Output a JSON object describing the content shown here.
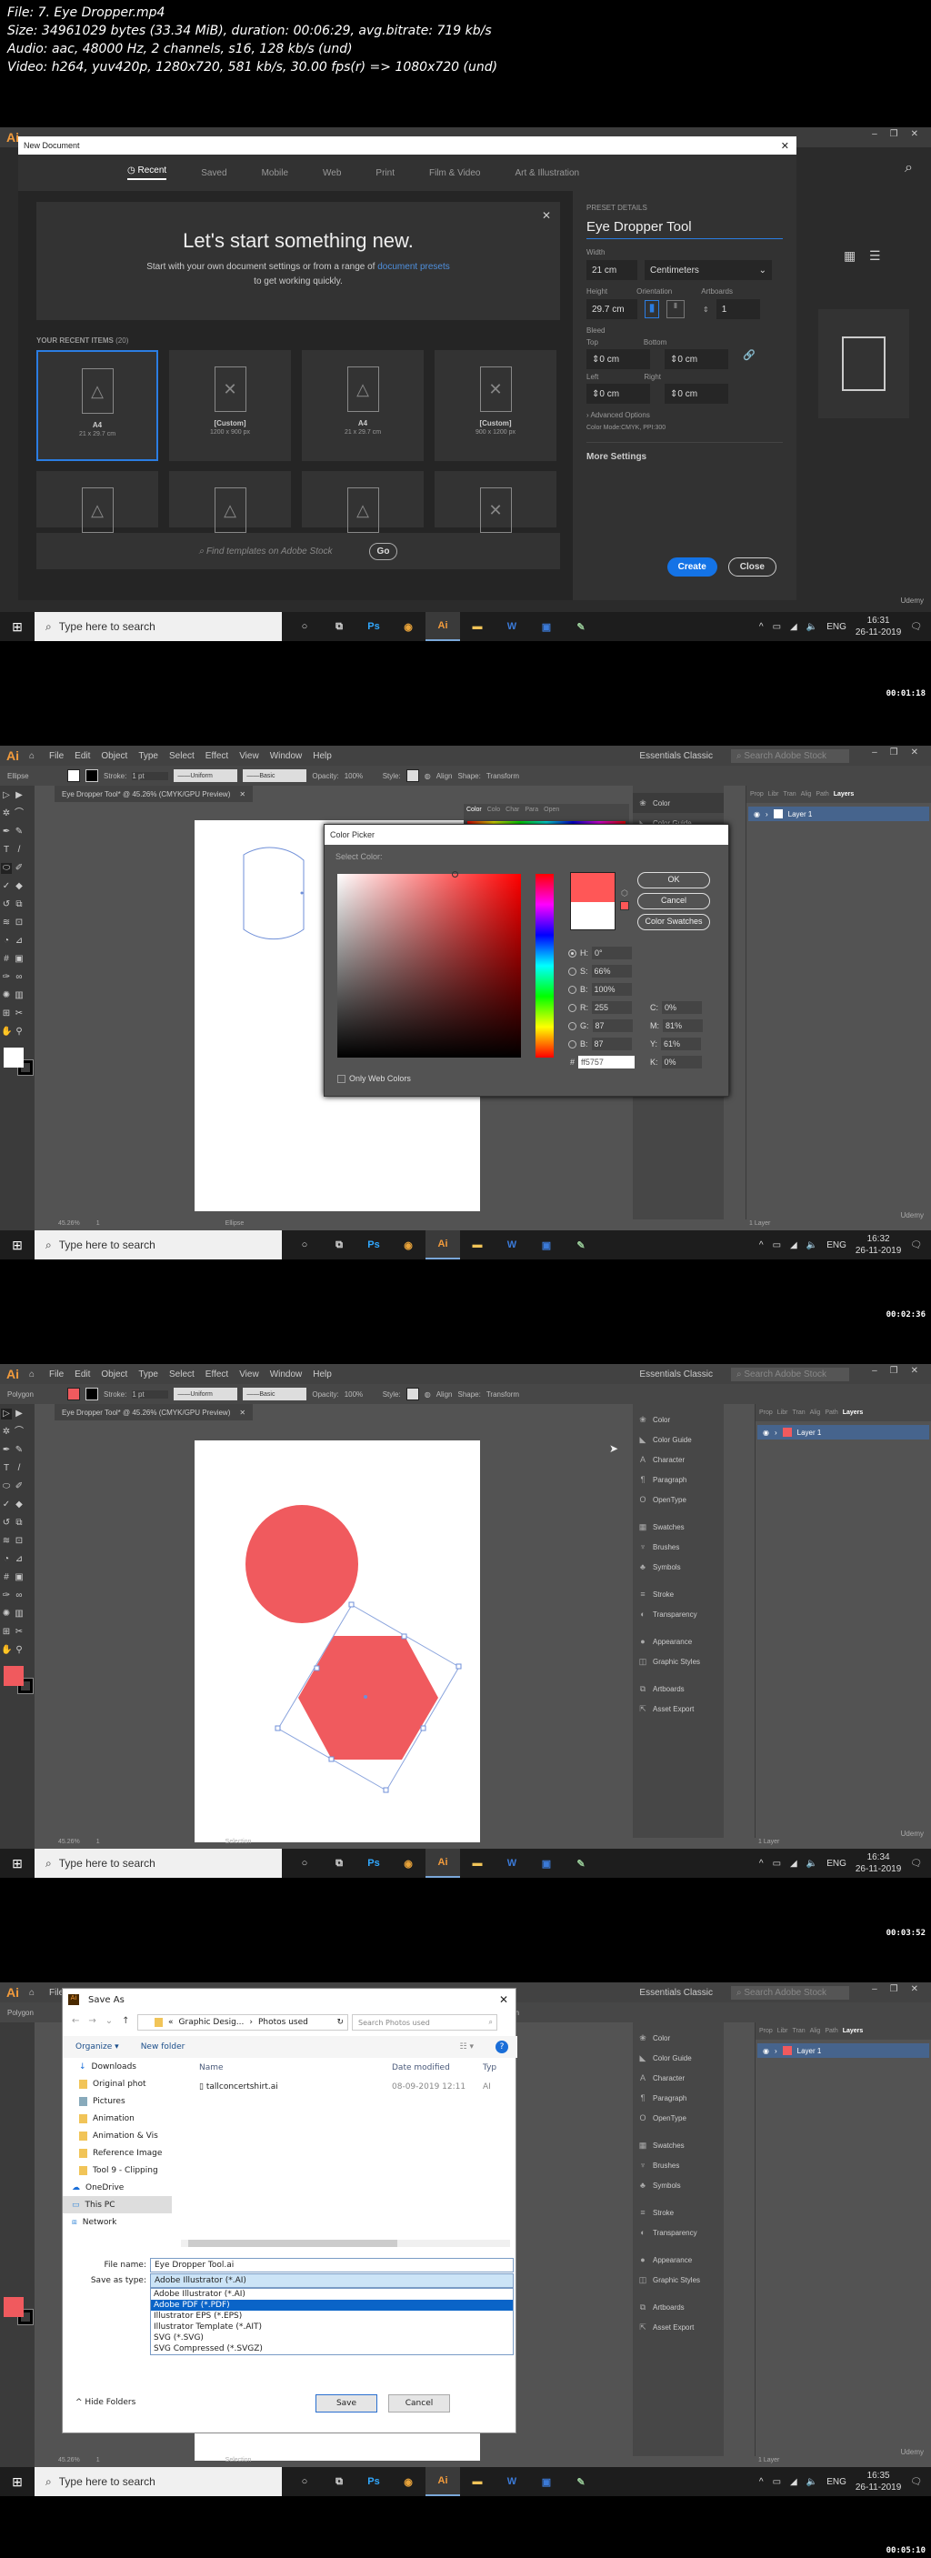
{
  "meta": {
    "file": "File: 7. Eye Dropper.mp4",
    "size": "Size: 34961029 bytes (33.34 MiB), duration: 00:06:29, avg.bitrate: 719 kb/s",
    "audio": "Audio: aac, 48000 Hz, 2 channels, s16, 128 kb/s (und)",
    "video": "Video: h264, yuv420p, 1280x720, 581 kb/s, 30.00 fps(r) => 1080x720 (und)"
  },
  "taskbar": {
    "search_placeholder": "Type here to search",
    "apps": [
      "Cortana",
      "Task View",
      "Ps",
      "Chrome",
      "Ai",
      "Explorer",
      "W",
      "App",
      "App2"
    ],
    "lang": "ENG",
    "date": "26-11-2019",
    "notifications": "1"
  },
  "watermark": "Udemy",
  "frames": [
    {
      "timestamp": "00:01:18",
      "clock": "16:31",
      "new_document": {
        "title": "New Document",
        "tabs": [
          "Recent",
          "Saved",
          "Mobile",
          "Web",
          "Print",
          "Film & Video",
          "Art & Illustration"
        ],
        "active_tab": "Recent",
        "hero_title": "Let's start something new.",
        "hero_text_1": "Start with your own document settings or from a range of",
        "hero_link": "document presets",
        "hero_text_2": "to get working quickly.",
        "recent_label": "YOUR RECENT ITEMS",
        "recent_count": "(20)",
        "recent_items": [
          {
            "name": "A4",
            "size": "21 x 29.7 cm",
            "selected": true
          },
          {
            "name": "[Custom]",
            "size": "1200 x 900 px"
          },
          {
            "name": "A4",
            "size": "21 x 29.7 cm"
          },
          {
            "name": "[Custom]",
            "size": "900 x 1200 px"
          }
        ],
        "stock_placeholder": "Find templates on Adobe Stock",
        "go_label": "Go",
        "preset": {
          "heading": "PRESET DETAILS",
          "name": "Eye Dropper Tool",
          "width_label": "Width",
          "width": "21 cm",
          "units": "Centimeters",
          "height_label": "Height",
          "height": "29.7 cm",
          "orientation_label": "Orientation",
          "artboards_label": "Artboards",
          "artboards": "1",
          "bleed_label": "Bleed",
          "top_label": "Top",
          "top": "0 cm",
          "bottom_label": "Bottom",
          "bottom": "0 cm",
          "left_label": "Left",
          "left": "0 cm",
          "right_label": "Right",
          "right": "0 cm",
          "advanced": "Advanced Options",
          "color_mode": "Color Mode:CMYK, PPI:300",
          "more_settings": "More Settings",
          "create_label": "Create",
          "close_label": "Close"
        }
      }
    },
    {
      "timestamp": "00:02:36",
      "clock": "16:32",
      "menu": [
        "File",
        "Edit",
        "Object",
        "Type",
        "Select",
        "Effect",
        "View",
        "Window",
        "Help"
      ],
      "tool_name": "Ellipse",
      "stroke_label": "Stroke:",
      "stroke_value": "1 pt",
      "uniform": "Uniform",
      "basic": "Basic",
      "opacity_label": "Opacity:",
      "opacity": "100%",
      "style_label": "Style:",
      "align": "Align",
      "shape": "Shape:",
      "transform": "Transform",
      "workspace": "Essentials Classic",
      "stock_search": "Search Adobe Stock",
      "doc_tab": "Eye Dropper Tool* @ 45.26% (CMYK/GPU Preview)",
      "color_tabs": [
        "Color",
        "Colo",
        "Char",
        "Para",
        "Open"
      ],
      "layers_tabs": [
        "Prop",
        "Libr",
        "Tran",
        "Alig",
        "Path",
        "Layers"
      ],
      "layer_name": "Layer 1",
      "zoom": "45.26%",
      "artboard_num": "1",
      "status_tool": "Ellipse",
      "layers_count": "1 Layer",
      "color_picker": {
        "title": "Color Picker",
        "select_label": "Select Color:",
        "ok": "OK",
        "cancel": "Cancel",
        "swatches": "Color Swatches",
        "h": "0°",
        "s": "66%",
        "b": "100%",
        "r": "255",
        "g": "87",
        "bl": "87",
        "c": "0%",
        "m": "81%",
        "y": "61%",
        "k": "0%",
        "hex": "ff5757",
        "web_only": "Only Web Colors",
        "new_color": "#ff5757",
        "old_color": "#ffffff"
      },
      "panel_items": [
        "Color",
        "Color Guide"
      ]
    },
    {
      "timestamp": "00:03:52",
      "clock": "16:34",
      "tool_name": "Polygon",
      "fill_color": "#f05a5e",
      "status_tool": "Selection",
      "panel_items": [
        "Color",
        "Color Guide",
        "Character",
        "Paragraph",
        "OpenType",
        "Swatches",
        "Brushes",
        "Symbols",
        "Stroke",
        "Transparency",
        "Appearance",
        "Graphic Styles",
        "Artboards",
        "Asset Export"
      ]
    },
    {
      "timestamp": "00:05:10",
      "clock": "16:35",
      "tool_name": "Polygon",
      "status_tool": "Selection",
      "save_as": {
        "title": "Save As",
        "breadcrumb_1": "Graphic Desig...",
        "breadcrumb_2": "Photos used",
        "search_placeholder": "Search Photos used",
        "organize": "Organize ▾",
        "new_folder": "New folder",
        "nav": [
          "Downloads",
          "Original phot",
          "Pictures",
          "Animation",
          "Animation & Vis",
          "Reference Image",
          "Tool 9 - Clipping",
          "OneDrive",
          "This PC",
          "Network"
        ],
        "col_name": "Name",
        "col_date": "Date modified",
        "col_type": "Typ",
        "files": [
          {
            "name": "tallconcertshirt.ai",
            "date": "08-09-2019 12:11",
            "type": "AI"
          }
        ],
        "file_name_label": "File name:",
        "file_name": "Eye Dropper Tool.ai",
        "type_label": "Save as type:",
        "type_value": "Adobe Illustrator (*.AI)",
        "type_options": [
          "Adobe Illustrator (*.AI)",
          "Adobe PDF (*.PDF)",
          "Illustrator EPS (*.EPS)",
          "Illustrator Template (*.AIT)",
          "SVG (*.SVG)",
          "SVG Compressed (*.SVGZ)"
        ],
        "highlighted_option": "Adobe PDF (*.PDF)",
        "hide_folders": "Hide Folders",
        "save": "Save",
        "cancel": "Cancel"
      }
    }
  ]
}
